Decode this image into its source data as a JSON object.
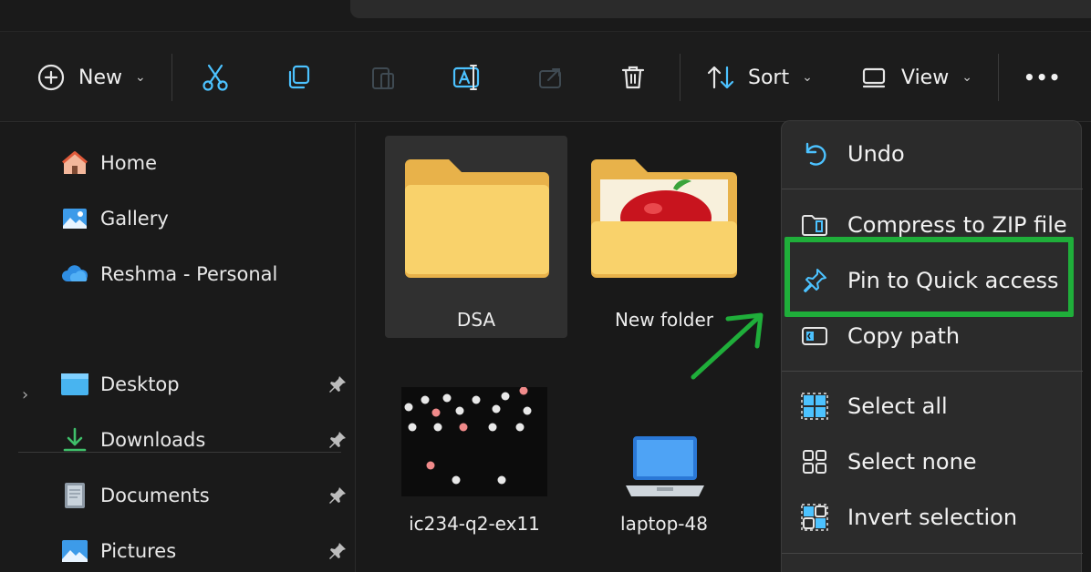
{
  "toolbar": {
    "new_label": "New",
    "sort_label": "Sort",
    "view_label": "View",
    "more_label": "•••",
    "chevron": "⌄"
  },
  "sidebar": {
    "items": [
      {
        "label": "Home",
        "icon": "home-icon"
      },
      {
        "label": "Gallery",
        "icon": "gallery-icon"
      },
      {
        "label": "Reshma - Personal",
        "icon": "cloud-icon"
      }
    ],
    "expander": "›",
    "quick_access": [
      {
        "label": "Desktop",
        "icon": "desktop-folder-icon",
        "pinned": true
      },
      {
        "label": "Downloads",
        "icon": "download-icon",
        "pinned": true
      },
      {
        "label": "Documents",
        "icon": "documents-icon",
        "pinned": true
      },
      {
        "label": "Pictures",
        "icon": "pictures-icon",
        "pinned": true
      }
    ]
  },
  "files": [
    {
      "name": "DSA",
      "type": "folder",
      "selected": true
    },
    {
      "name": "New folder",
      "type": "folder-apple",
      "selected": false
    },
    {
      "name": "ic234-q2-ex11",
      "type": "image",
      "selected": false
    },
    {
      "name": "laptop-48",
      "type": "image",
      "selected": false
    }
  ],
  "context_menu": {
    "items": [
      {
        "label": "Undo",
        "icon": "undo-icon"
      },
      {
        "label": "Compress to ZIP file",
        "icon": "zip-icon"
      },
      {
        "label": "Pin to Quick access",
        "icon": "pin-icon",
        "highlighted": true
      },
      {
        "label": "Copy path",
        "icon": "copy-path-icon"
      },
      {
        "label": "Select all",
        "icon": "select-all-icon"
      },
      {
        "label": "Select none",
        "icon": "select-none-icon"
      },
      {
        "label": "Invert selection",
        "icon": "invert-selection-icon"
      }
    ]
  },
  "colors": {
    "accent": "#4cc2ff",
    "highlight": "#1fae3a",
    "folder": "#f8cf5a"
  }
}
